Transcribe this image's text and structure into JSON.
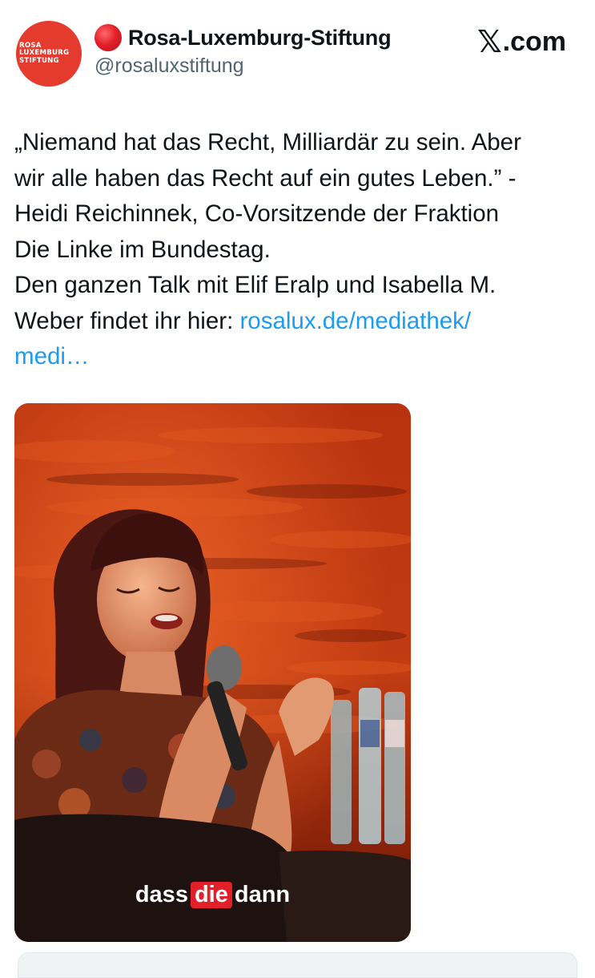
{
  "profile": {
    "logo_lines": [
      "ROSA",
      "LUXEMBURG",
      "STIFTUNG"
    ],
    "display_name": "Rosa-Luxemburg-Stiftung",
    "handle": "@rosaluxstiftung",
    "status_emoji": "red-circle-icon"
  },
  "site": {
    "label": ".com",
    "logo_icon": "x-logo-icon"
  },
  "tweet": {
    "lines": [
      "„Niemand hat das Recht, Milliardär zu sein. Aber",
      "wir alle haben das Recht auf ein gutes Leben.” -",
      "Heidi Reichinnek, Co-Vorsitzende der Fraktion",
      "Die Linke im Bundestag.",
      "Den ganzen Talk mit Elif Eralp und Isabella M."
    ],
    "last_line_prefix": "Weber findet ihr hier: ",
    "link_part1": "rosalux.de/mediathek/",
    "link_part2": "medi…"
  },
  "video": {
    "caption_before": "dass",
    "caption_highlight": "die",
    "caption_after": "dann"
  },
  "colors": {
    "accent_link": "#1d9bf0",
    "brand_red": "#e53a2e",
    "caption_highlight": "#e3202a"
  }
}
